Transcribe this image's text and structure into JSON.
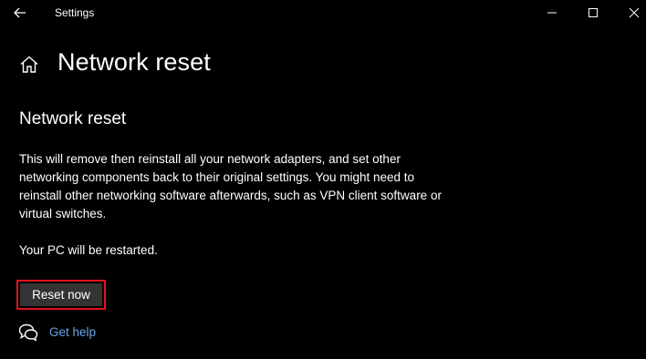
{
  "titlebar": {
    "app_title": "Settings"
  },
  "page": {
    "title": "Network reset"
  },
  "section": {
    "title": "Network reset",
    "description": "This will remove then reinstall all your network adapters, and set other networking components back to their original settings. You might need to reinstall other networking software afterwards, such as VPN client software or virtual switches.",
    "restart_note": "Your PC will be restarted."
  },
  "actions": {
    "reset_label": "Reset now",
    "help_label": "Get help"
  },
  "colors": {
    "background": "#000000",
    "button": "#333333",
    "highlight": "#e0141e",
    "link": "#6aa6ec"
  }
}
